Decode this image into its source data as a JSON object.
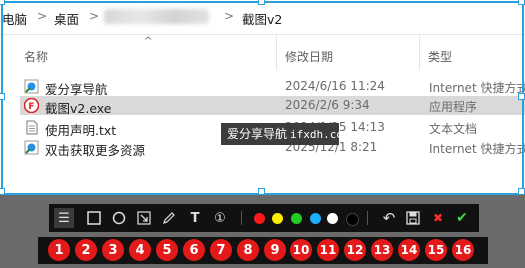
{
  "address_bar": {
    "crumbs": [
      "电脑",
      "桌面",
      "截图v2"
    ],
    "separator": ">"
  },
  "columns": {
    "name": "名称",
    "modified": "修改日期",
    "type": "类型"
  },
  "files": [
    {
      "name": "爱分享导航",
      "modified": "2024/6/16 11:24",
      "type": "Internet 快捷方式",
      "icon": "internet-shortcut-icon",
      "selected": false
    },
    {
      "name": "截图v2.exe",
      "modified": "2026/2/6 9:34",
      "type": "应用程序",
      "icon": "app-red-icon",
      "selected": true
    },
    {
      "name": "使用声明.txt",
      "modified": "2024/1/25 14:13",
      "type": "文本文档",
      "icon": "text-file-icon",
      "selected": false
    },
    {
      "name": "双击获取更多资源",
      "modified": "2025/12/1 8:21",
      "type": "Internet 快捷方式",
      "icon": "internet-shortcut-icon",
      "selected": false
    }
  ],
  "watermark": {
    "name": "爱分享导航",
    "site": "ifxdh.com"
  },
  "toolbar": {
    "menu_glyph": "☰",
    "text_glyph": "T",
    "number_glyph": "①",
    "undo_glyph": "↶",
    "close_glyph": "✖",
    "confirm_glyph": "✔",
    "colors": [
      "#ff1a1a",
      "#ffee00",
      "#22cc22",
      "#1ab0ff",
      "#ffffff",
      "#000000"
    ]
  },
  "numbers": [
    "1",
    "2",
    "3",
    "4",
    "5",
    "6",
    "7",
    "8",
    "9",
    "10",
    "11",
    "12",
    "13",
    "14",
    "15",
    "16"
  ]
}
